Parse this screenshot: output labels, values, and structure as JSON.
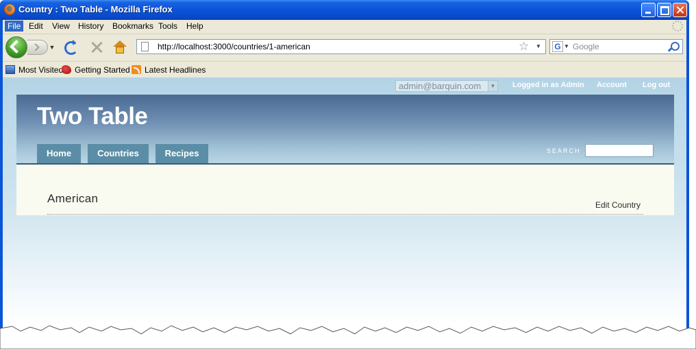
{
  "window": {
    "title": "Country : Two Table - Mozilla Firefox"
  },
  "menu": [
    "File",
    "Edit",
    "View",
    "History",
    "Bookmarks",
    "Tools",
    "Help"
  ],
  "toolbar": {
    "url": "http://localhost:3000/countries/1-american",
    "search_engine_text": "Google",
    "engine_letter": "G"
  },
  "bookmarks": [
    "Most Visited",
    "Getting Started",
    "Latest Headlines"
  ],
  "userbar": {
    "selected_user": "admin@barquin.com",
    "logged_in_text": "Logged in as Admin",
    "account_link": "Account",
    "logout_link": "Log out"
  },
  "site": {
    "title": "Two Table",
    "nav": [
      "Home",
      "Countries",
      "Recipes"
    ],
    "search_label": "SEARCH"
  },
  "content": {
    "heading": "American",
    "edit_link": "Edit Country"
  },
  "colors": {
    "titlebar": "#0a54d8",
    "header_top": "#4a6a92",
    "nav_tab": "#5b8ea6",
    "content_bg": "#f9fbf0"
  }
}
